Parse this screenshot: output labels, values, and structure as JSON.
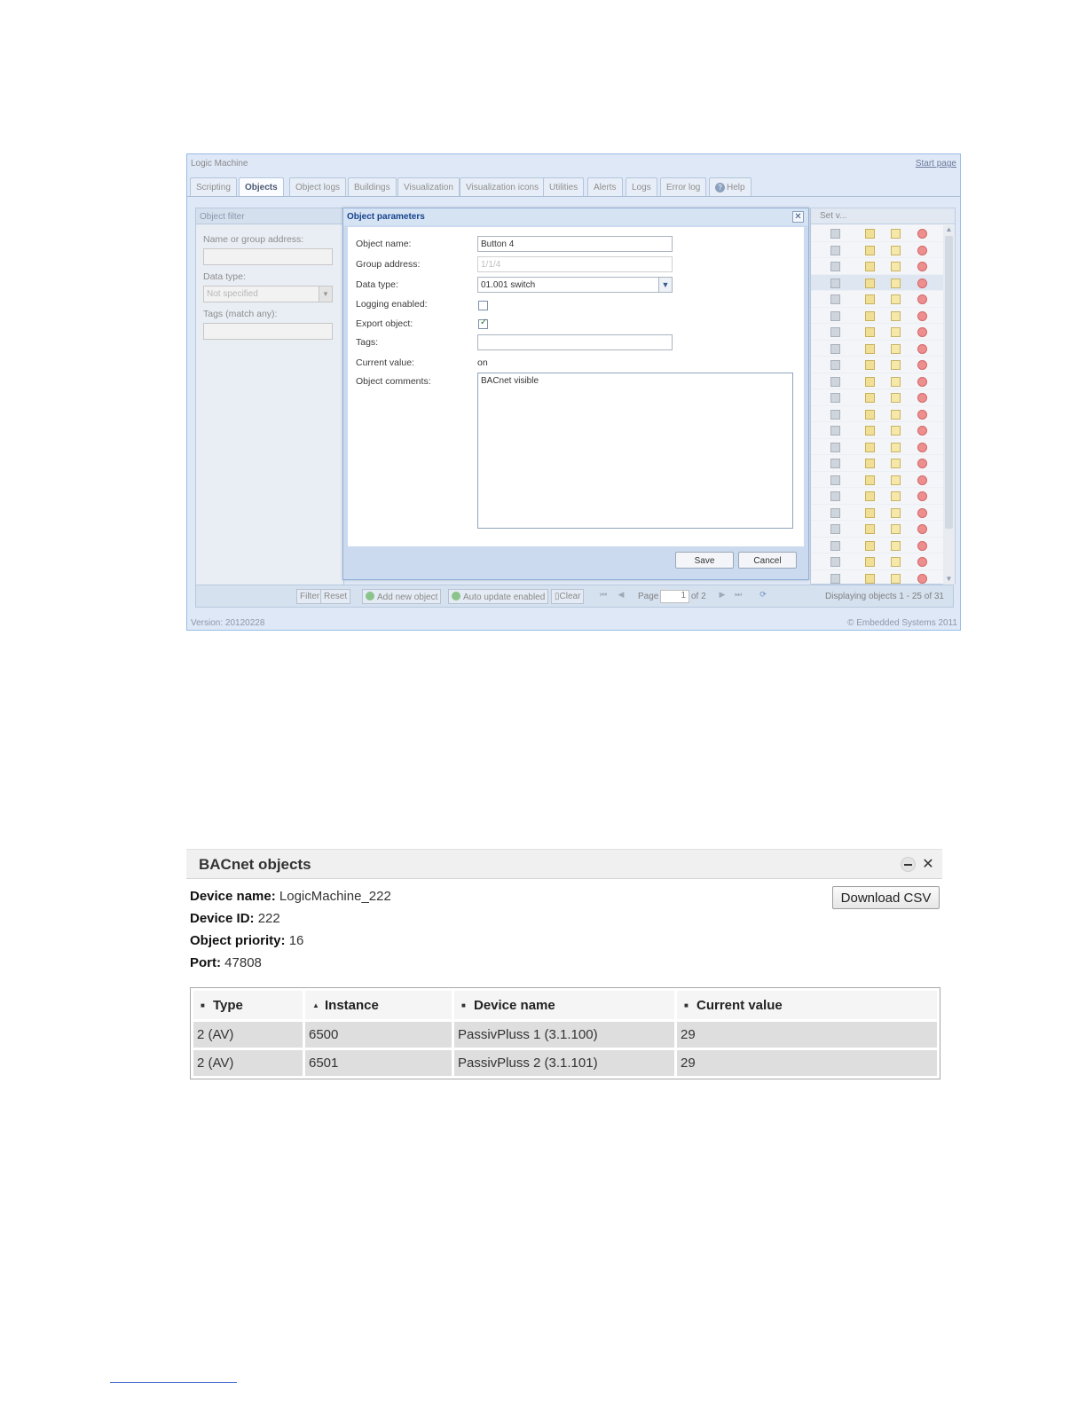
{
  "lm": {
    "app_title": "Logic Machine",
    "start_page": "Start page",
    "tabs": [
      {
        "label": "Scripting",
        "active": false
      },
      {
        "label": "Objects",
        "active": true
      },
      {
        "label": "Object logs",
        "active": false
      },
      {
        "label": "Buildings",
        "active": false
      },
      {
        "label": "Visualization",
        "active": false
      },
      {
        "label": "Visualization icons",
        "active": false
      },
      {
        "label": "Utilities",
        "active": false
      },
      {
        "label": "Alerts",
        "active": false
      },
      {
        "label": "Logs",
        "active": false
      },
      {
        "label": "Error log",
        "active": false
      },
      {
        "label": "Help",
        "active": false
      }
    ],
    "filter": {
      "title": "Object filter",
      "name_label": "Name or group address:",
      "type_label": "Data type:",
      "type_value": "Not specified",
      "tags_label": "Tags (match any):",
      "filter_btn": "Filter",
      "reset_btn": "Reset"
    },
    "grid": {
      "header": "Set v...",
      "selected_row": 3
    },
    "toolbar": {
      "add": "Add new object",
      "auto": "Auto update enabled",
      "clear": "Clear",
      "page_label": "Page",
      "page_value": "1",
      "of_pages": "of 2",
      "status": "Displaying objects 1 - 25 of 31"
    },
    "footer": {
      "version": "Version: 20120228",
      "copyright": "© Embedded Systems 2011"
    },
    "dialog": {
      "title": "Object parameters",
      "name_label": "Object name:",
      "name_value": "Button 4",
      "address_label": "Group address:",
      "address_value": "1/1/4",
      "type_label": "Data type:",
      "type_value": "01.001 switch",
      "logging_label": "Logging enabled:",
      "logging_checked": false,
      "export_label": "Export object:",
      "export_checked": true,
      "tags_label": "Tags:",
      "tags_value": "",
      "current_label": "Current value:",
      "current_value": "on",
      "comments_label": "Object comments:",
      "comments_value": "BACnet visible",
      "save": "Save",
      "cancel": "Cancel"
    }
  },
  "bacnet": {
    "title": "BACnet objects",
    "device_name_label": "Device name:",
    "device_name": "LogicMachine_222",
    "device_id_label": "Device ID:",
    "device_id": "222",
    "priority_label": "Object priority:",
    "priority": "16",
    "port_label": "Port:",
    "port": "47808",
    "download_csv": "Download CSV",
    "columns": [
      "Type",
      "Instance",
      "Device name",
      "Current value"
    ],
    "rows": [
      [
        "2 (AV)",
        "6500",
        "PassivPluss 1 (3.1.100)",
        "29"
      ],
      [
        "2 (AV)",
        "6501",
        "PassivPluss 2 (3.1.101)",
        "29"
      ]
    ]
  }
}
